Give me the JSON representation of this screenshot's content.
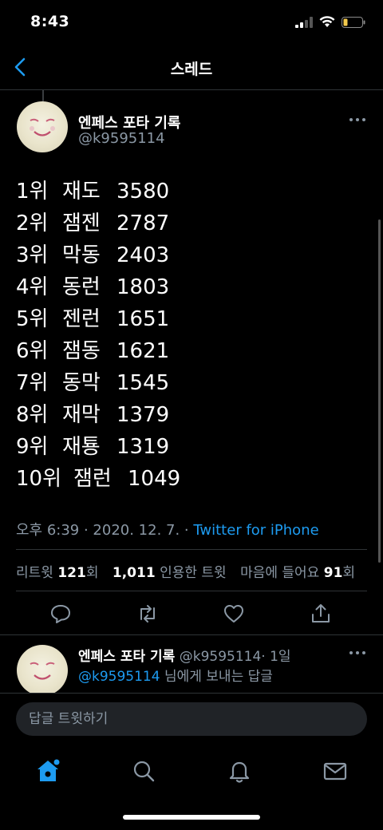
{
  "status_bar": {
    "time": "8:43"
  },
  "nav": {
    "title": "스레드"
  },
  "tweet": {
    "author_name": "엔페스 포타 기록",
    "author_handle": "@k9595114",
    "rankings": [
      {
        "rank": "1위",
        "name": "재도",
        "score": "3580"
      },
      {
        "rank": "2위",
        "name": "잼젠",
        "score": "2787"
      },
      {
        "rank": "3위",
        "name": "막동",
        "score": "2403"
      },
      {
        "rank": "4위",
        "name": "동런",
        "score": "1803"
      },
      {
        "rank": "5위",
        "name": "젠런",
        "score": "1651"
      },
      {
        "rank": "6위",
        "name": "잼동",
        "score": "1621"
      },
      {
        "rank": "7위",
        "name": "동막",
        "score": "1545"
      },
      {
        "rank": "8위",
        "name": "재막",
        "score": "1379"
      },
      {
        "rank": "9위",
        "name": "재툥",
        "score": "1319"
      },
      {
        "rank": "10위",
        "name": "잼런",
        "score": "1049"
      }
    ],
    "timestamp": "오후 6:39 · 2020. 12. 7. ·",
    "source": "Twitter for iPhone",
    "stats": {
      "retweets_label": "리트윗",
      "retweets": "121",
      "retweets_unit": "회",
      "quotes": "1,011",
      "quotes_label": "인용한 트윗",
      "likes_label": "마음에 들어요",
      "likes": "91",
      "likes_unit": "회"
    }
  },
  "reply": {
    "author_name": "엔페스 포타 기록",
    "author_handle": "@k9595114",
    "time": "· 1일",
    "mention": "@k9595114",
    "suffix": "님에게 보내는 답글"
  },
  "compose": {
    "placeholder": "답글 트윗하기"
  },
  "colors": {
    "accent": "#1d9bf0",
    "secondary_text": "#8b98a5",
    "background": "#000000"
  },
  "icons": [
    "back-arrow-icon",
    "more-icon",
    "reply-icon",
    "retweet-icon",
    "like-icon",
    "share-icon",
    "home-icon",
    "search-icon",
    "notifications-icon",
    "messages-icon"
  ]
}
